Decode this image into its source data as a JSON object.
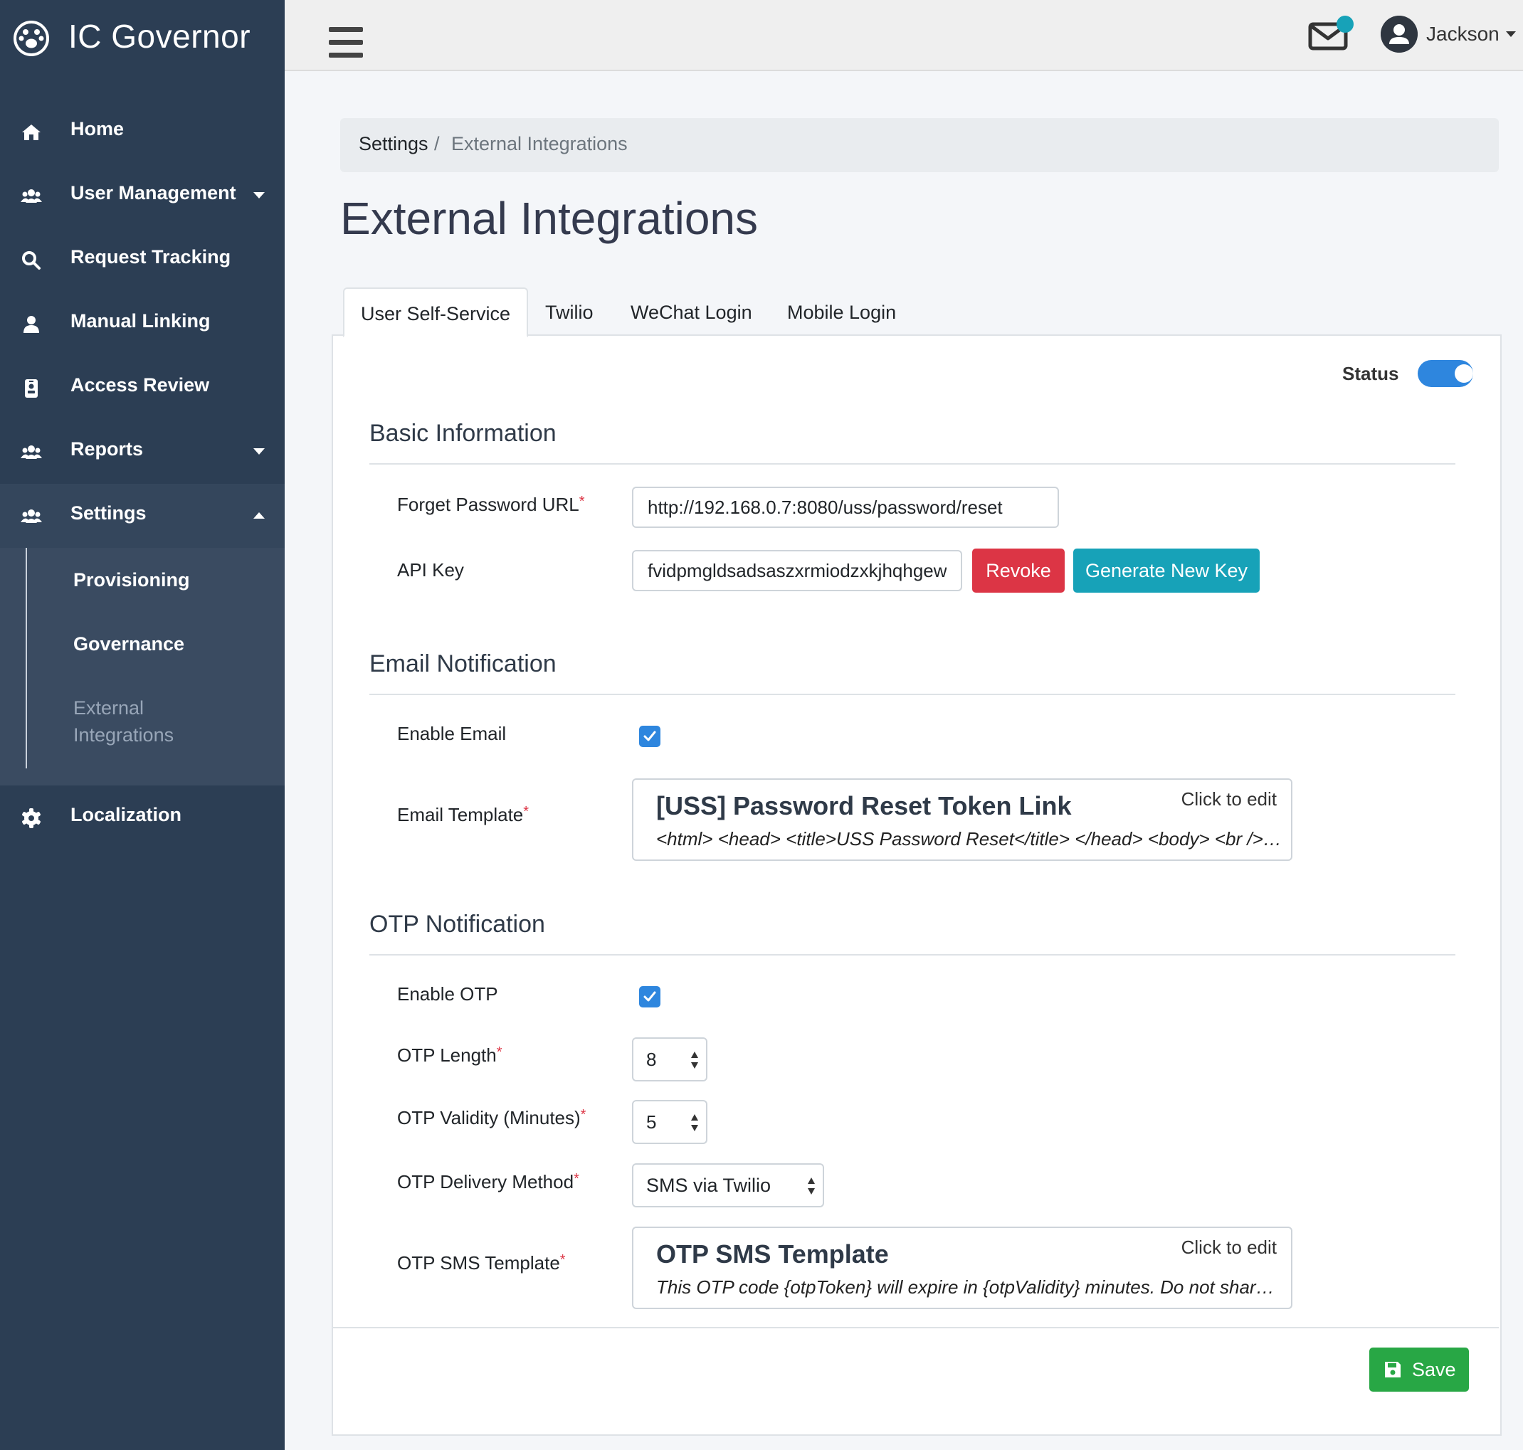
{
  "app": {
    "brand": "IC Governor"
  },
  "sidebar": {
    "items": [
      {
        "label": "Home",
        "icon": "home-icon"
      },
      {
        "label": "User Management",
        "icon": "users-icon"
      },
      {
        "label": "Request Tracking",
        "icon": "search-icon"
      },
      {
        "label": "Manual Linking",
        "icon": "user-icon"
      },
      {
        "label": "Access Review",
        "icon": "id-badge-icon"
      },
      {
        "label": "Reports",
        "icon": "users-icon"
      },
      {
        "label": "Settings",
        "icon": "users-icon"
      },
      {
        "label": "Localization",
        "icon": "gear-icon"
      }
    ],
    "settings_submenu": [
      "Provisioning",
      "Governance",
      "External Integrations"
    ]
  },
  "topbar": {
    "user": "Jackson"
  },
  "breadcrumb": {
    "parent": "Settings",
    "separator": "/",
    "current": "External Integrations"
  },
  "page": {
    "title": "External Integrations"
  },
  "tabs": [
    "User Self-Service",
    "Twilio",
    "WeChat Login",
    "Mobile Login"
  ],
  "status": {
    "label": "Status",
    "enabled": true
  },
  "basic_info": {
    "title": "Basic Information",
    "forget_password_label": "Forget Password URL",
    "forget_password_value": "http://192.168.0.7:8080/uss/password/reset",
    "api_key_label": "API Key",
    "api_key_value": "fvidpmgldsadsaszxrmiodzxkjhqhgewq",
    "revoke_label": "Revoke",
    "generate_label": "Generate New Key"
  },
  "email": {
    "title": "Email Notification",
    "enable_label": "Enable Email",
    "enabled": true,
    "template_label": "Email Template",
    "template_title": "[USS] Password Reset Token Link",
    "template_body": "<html> <head> <title>USS Password Reset</title> </head> <body> <br /> <p>Hello</p>",
    "click_to_edit": "Click to edit"
  },
  "otp": {
    "title": "OTP Notification",
    "enable_label": "Enable OTP",
    "enabled": true,
    "length_label": "OTP Length",
    "length_value": "8",
    "validity_label": "OTP Validity (Minutes)",
    "validity_value": "5",
    "delivery_label": "OTP Delivery Method",
    "delivery_value": "SMS via Twilio",
    "sms_template_label": "OTP SMS Template",
    "sms_template_title": "OTP SMS Template",
    "sms_template_body": "This OTP code {otpToken} will expire in {otpValidity} minutes. Do not share this code with anyone.",
    "click_to_edit": "Click to edit"
  },
  "footer": {
    "save_label": "Save"
  },
  "colors": {
    "sidebar": "#2c3e54",
    "accent": "#2e86de",
    "danger": "#dc3545",
    "info": "#17a2b8",
    "success": "#28a745"
  }
}
